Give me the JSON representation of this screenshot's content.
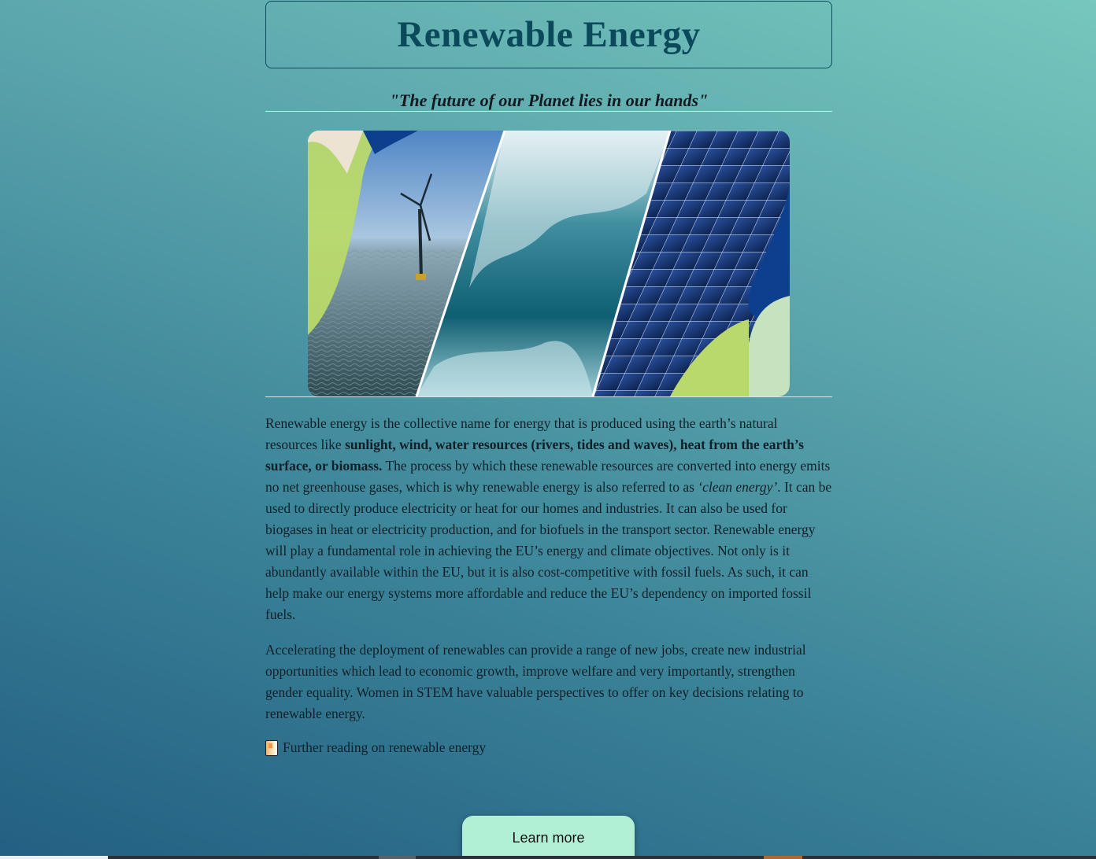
{
  "header": {
    "title": "Renewable Energy",
    "quote": "\"The future of our Planet lies in our hands\""
  },
  "hero": {
    "image_alt": "Wind turbine, ocean waves and solar panels",
    "panels": [
      "wind-turbine",
      "ocean-waves",
      "solar-panels"
    ]
  },
  "content": {
    "p1": {
      "a": "Renewable energy is the collective name for energy that is produced using the earth’s natural resources like ",
      "b": "sunlight, wind, water resources (rivers, tides and waves), heat from the earth’s surface, or biomass.",
      "c": " The process by which these renewable resources are converted into energy emits no net greenhouse gases, which is why renewable energy is also referred to as ",
      "d": "‘clean energy’",
      "e": ". It can be used to directly produce electricity or heat for our homes and industries. It can also be used for biogases in heat or electricity production, and for biofuels in the transport sector. Renewable energy will play a fundamental role in achieving the EU’s energy and climate objectives. Not only is it abundantly available within the EU, but it is also cost-competitive with fossil fuels. As such, it can help make our energy systems more affordable and reduce the EU’s dependency on imported fossil fuels."
    },
    "p2": "Accelerating the deployment of renewables can provide a range of new jobs, create new industrial opportunities which lead to economic growth, improve welfare and very importantly, strengthen gender equality. Women in STEM have valuable perspectives to offer on key decisions relating to renewable energy.",
    "further_reading": "Further reading on renewable energy",
    "further_reading_icon": "book-icon"
  },
  "actions": {
    "learn_more": "Learn more"
  },
  "colors": {
    "title": "#0b4a5b",
    "button": "#b2f0d6",
    "gradient_top": "#76c7bd",
    "gradient_bottom": "#235f82"
  }
}
